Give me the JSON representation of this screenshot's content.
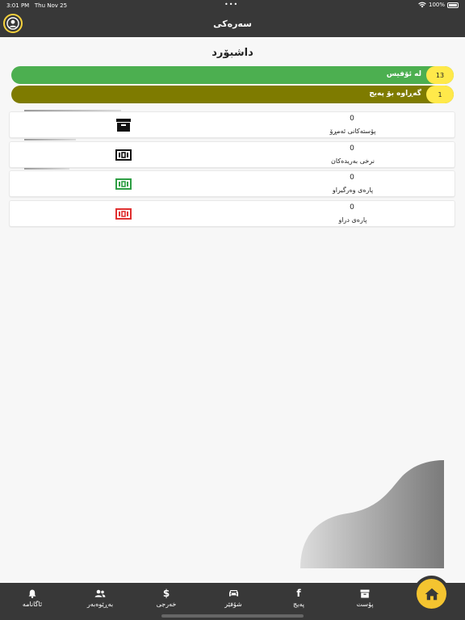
{
  "status_bar": {
    "time": "3:01 PM",
    "date": "Thu Nov 25",
    "battery": "100%"
  },
  "header": {
    "title": "سەرەکی",
    "avatar_icon": "user-circle-icon"
  },
  "page": {
    "title": "داشبۆرد"
  },
  "status_pills": [
    {
      "label": "لە ئۆفیس",
      "count": "13",
      "color": "#4caf50"
    },
    {
      "label": "گەڕاوە بۆ پەیج",
      "count": "1",
      "color": "#7e7b00"
    }
  ],
  "stats": [
    {
      "value": "0",
      "label": "پۆستەکانی ئەمڕۆ",
      "icon": "archive-box-icon",
      "icon_color": "#111111"
    },
    {
      "value": "0",
      "label": "نرخی بەریدەکان",
      "icon": "banknote-icon",
      "icon_color": "#111111"
    },
    {
      "value": "0",
      "label": "پارەی وەرگیراو",
      "icon": "banknote-icon",
      "icon_color": "#2e9e44"
    },
    {
      "value": "0",
      "label": "پارەی دراو",
      "icon": "banknote-icon",
      "icon_color": "#e03030"
    }
  ],
  "tabs": [
    {
      "label": "ئاگانامە",
      "icon": "bell-icon"
    },
    {
      "label": "بەڕێوەبەر",
      "icon": "users-icon"
    },
    {
      "label": "خەرجی",
      "icon": "dollar-icon"
    },
    {
      "label": "شۆفێر",
      "icon": "car-icon"
    },
    {
      "label": "پەیج",
      "icon": "facebook-icon"
    },
    {
      "label": "پۆست",
      "icon": "archive-box-icon"
    }
  ],
  "home_icon": "home-icon",
  "colors": {
    "bar": "#383838",
    "accent": "#f4c430",
    "background": "#f7f7f7"
  }
}
